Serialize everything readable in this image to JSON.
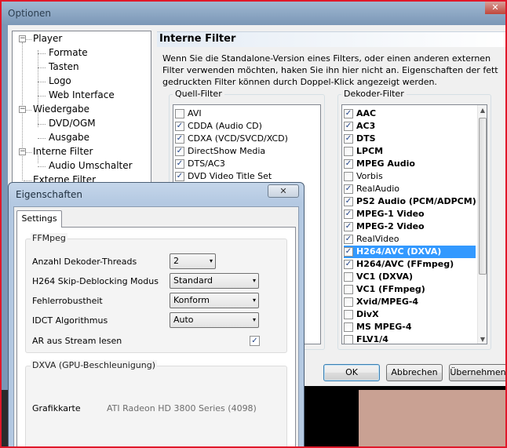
{
  "window": {
    "title": "Optionen",
    "close_label": "✕"
  },
  "tree": {
    "items": [
      {
        "label": "Player",
        "expander": "−"
      },
      {
        "label": "Formate"
      },
      {
        "label": "Tasten"
      },
      {
        "label": "Logo"
      },
      {
        "label": "Web Interface"
      },
      {
        "label": "Wiedergabe",
        "expander": "−"
      },
      {
        "label": "DVD/OGM"
      },
      {
        "label": "Ausgabe"
      },
      {
        "label": "Interne Filter",
        "expander": "−"
      },
      {
        "label": "Audio Umschalter"
      },
      {
        "label": "Externe Filter"
      }
    ]
  },
  "panel": {
    "title": "Interne Filter",
    "description": "Wenn Sie die Standalone-Version eines Filters, oder einen anderen externen Filter verwenden möchten, haken Sie ihn hier nicht an. Eigenschaften der fett gedruckten Filter können durch Doppel-Klick angezeigt werden."
  },
  "source_filters": {
    "label": "Quell-Filter",
    "items": [
      {
        "label": "AVI",
        "checked": ""
      },
      {
        "label": "CDDA (Audio CD)",
        "checked": "✓"
      },
      {
        "label": "CDXA (VCD/SVCD/XCD)",
        "checked": "✓"
      },
      {
        "label": "DirectShow Media",
        "checked": "✓"
      },
      {
        "label": "DTS/AC3",
        "checked": "✓"
      },
      {
        "label": "DVD Video Title Set",
        "checked": "✓"
      }
    ]
  },
  "decoder_filters": {
    "label": "Dekoder-Filter",
    "items": [
      {
        "label": "AAC",
        "checked": "✓",
        "bold": true
      },
      {
        "label": "AC3",
        "checked": "✓",
        "bold": true
      },
      {
        "label": "DTS",
        "checked": "✓",
        "bold": true
      },
      {
        "label": "LPCM",
        "checked": "",
        "bold": true
      },
      {
        "label": "MPEG Audio",
        "checked": "✓",
        "bold": true
      },
      {
        "label": "Vorbis",
        "checked": "",
        "bold": false
      },
      {
        "label": "RealAudio",
        "checked": "✓",
        "bold": false
      },
      {
        "label": "PS2 Audio (PCM/ADPCM)",
        "checked": "✓",
        "bold": true
      },
      {
        "label": "MPEG-1 Video",
        "checked": "✓",
        "bold": true
      },
      {
        "label": "MPEG-2 Video",
        "checked": "✓",
        "bold": true
      },
      {
        "label": "RealVideo",
        "checked": "✓",
        "bold": false
      },
      {
        "label": "H264/AVC (DXVA)",
        "checked": "✓",
        "bold": true,
        "selected": true
      },
      {
        "label": "H264/AVC (FFmpeg)",
        "checked": "✓",
        "bold": true
      },
      {
        "label": "VC1 (DXVA)",
        "checked": "",
        "bold": true
      },
      {
        "label": "VC1 (FFmpeg)",
        "checked": "",
        "bold": true
      },
      {
        "label": "Xvid/MPEG-4",
        "checked": "",
        "bold": true
      },
      {
        "label": "DivX",
        "checked": "",
        "bold": true
      },
      {
        "label": "MS MPEG-4",
        "checked": "",
        "bold": true
      },
      {
        "label": "FLV1/4",
        "checked": "",
        "bold": true
      }
    ]
  },
  "buttons": {
    "ok": "OK",
    "cancel": "Abbrechen",
    "apply": "Übernehmen"
  },
  "dialog": {
    "title": "Eigenschaften",
    "close_label": "✕",
    "tab": "Settings",
    "ffmpeg": {
      "label": "FFMpeg",
      "threads_label": "Anzahl Dekoder-Threads",
      "threads_value": "2",
      "skip_label": "H264 Skip-Deblocking Modus",
      "skip_value": "Standard",
      "robust_label": "Fehlerrobustheit",
      "robust_value": "Konform",
      "idct_label": "IDCT Algorithmus",
      "idct_value": "Auto",
      "ar_label": "AR aus Stream lesen",
      "ar_checked": "✓"
    },
    "dxva": {
      "label": "DXVA (GPU-Beschleunigung)",
      "card_label": "Grafikkarte",
      "card_value": "ATI Radeon HD 3800 Series (4098)"
    }
  },
  "icons": {
    "dropdown": "▾",
    "scroll_up": "▲",
    "scroll_down": "▼"
  }
}
